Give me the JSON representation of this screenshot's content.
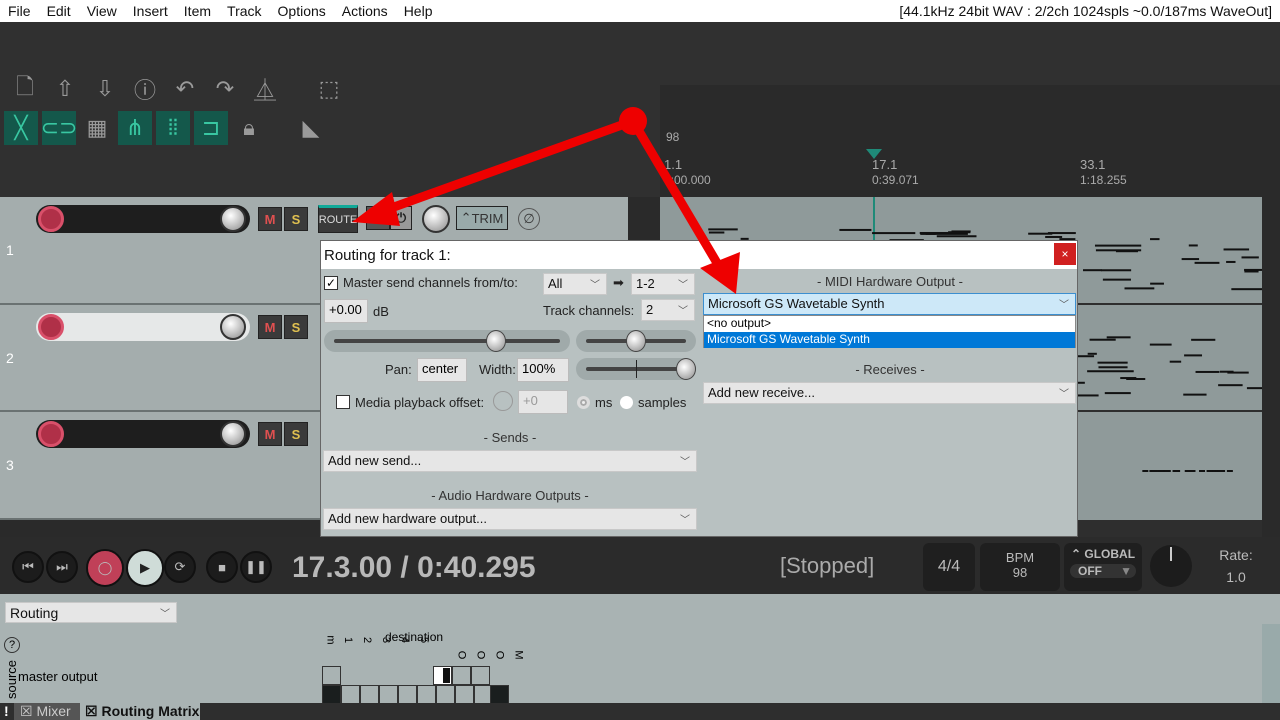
{
  "menu": {
    "items": [
      "File",
      "Edit",
      "View",
      "Insert",
      "Item",
      "Track",
      "Options",
      "Actions",
      "Help"
    ],
    "status": "[44.1kHz 24bit WAV : 2/2ch 1024spls ~0.0/187ms WaveOut]"
  },
  "toolbar": {
    "row1": [
      "new-project-icon",
      "open-project-icon",
      "save-project-icon",
      "project-info-icon",
      "undo-icon",
      "redo-icon",
      "metronome-icon",
      "marquee-icon"
    ],
    "row2": [
      "crossfade-icon",
      "link-icon",
      "grid-icon",
      "ripple-link-icon",
      "snap-grid-icon",
      "magnet-icon",
      "lock-icon",
      "trim-icon"
    ]
  },
  "ruler": {
    "tempo": "98",
    "markers": [
      {
        "bar": "1.1",
        "time": "0:00.000"
      },
      {
        "bar": "17.1",
        "time": "0:39.071"
      },
      {
        "bar": "33.1",
        "time": "1:18.255"
      }
    ],
    "item_buttons": [
      "M",
      "FX"
    ]
  },
  "tracks": [
    {
      "number": "1",
      "name": ""
    },
    {
      "number": "2",
      "name": ""
    },
    {
      "number": "3",
      "name": ""
    }
  ],
  "track_buttons": {
    "mute": "M",
    "solo": "S",
    "route": "ROUTE",
    "fx": "FX",
    "trim": "TRIM"
  },
  "dialog": {
    "title": "Routing for track 1:",
    "close": "×",
    "master_send_label": "Master send channels from/to:",
    "master_send_checked": true,
    "from_channels": "All",
    "to_channels": "1-2",
    "arrow": "➡",
    "volume": "+0.00",
    "volume_unit": "dB",
    "track_channels_label": "Track channels:",
    "track_channels": "2",
    "pan_label": "Pan:",
    "pan": "center",
    "width_label": "Width:",
    "width": "100%",
    "media_offset_label": "Media playback offset:",
    "media_offset_checked": false,
    "media_offset": "+0",
    "unit_ms": "ms",
    "unit_samples": "samples",
    "sends_header": "- Sends -",
    "add_send": "Add new send...",
    "hw_header": "- Audio Hardware Outputs -",
    "add_hw": "Add new hardware output...",
    "midi_header": "- MIDI Hardware Output -",
    "midi_selected": "Microsoft GS Wavetable Synth",
    "midi_options": [
      "<no output>",
      "Microsoft GS Wavetable Synth"
    ],
    "receives_header": "- Receives -",
    "add_receive": "Add new receive...",
    "volume_fader_fraction": 0.72,
    "pan_fraction": 0.5,
    "width_fraction": 1.0
  },
  "transport": {
    "position": "17.3.00 / 0:40.295",
    "state": "[Stopped]",
    "time_sig": "4/4",
    "bpm_label": "BPM",
    "bpm": "98",
    "global_label": "GLOBAL",
    "global_value": "OFF",
    "rate_label": "Rate:",
    "rate": "1.0"
  },
  "docker": {
    "view_select": "Routing",
    "help": "?",
    "destination_label": "destination",
    "source_label": "source",
    "source_row": "master output",
    "dest_cols": [
      "m",
      "1",
      "2",
      "3",
      "4",
      "5",
      "O",
      "O",
      "O",
      "M"
    ]
  },
  "tabs": [
    {
      "label": "Mixer"
    },
    {
      "label": "Routing Matrix",
      "active": true
    }
  ],
  "colors": {
    "annotation_arrow": "#ee0000",
    "accent_teal": "#39c7a2",
    "selection": "#0078d7"
  }
}
